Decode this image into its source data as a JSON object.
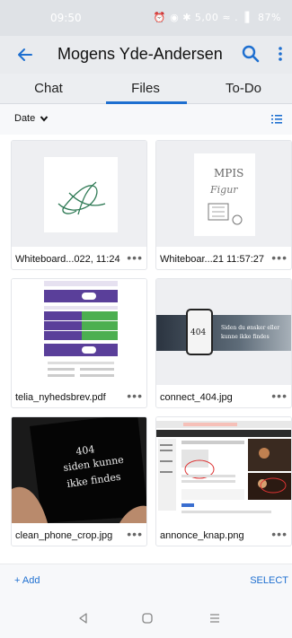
{
  "status_bar": {
    "time": "09:50",
    "right_text": "⏰ ◉ ✱ 5,00 ≈ .▕▍ 87%"
  },
  "header": {
    "title": "Mogens Yde-Andersen"
  },
  "tabs": [
    {
      "label": "Chat",
      "selected": false
    },
    {
      "label": "Files",
      "selected": true
    },
    {
      "label": "To-Do",
      "selected": false
    }
  ],
  "sort": {
    "label": "Date"
  },
  "files": [
    {
      "name": "Whiteboard...022, 11:24",
      "thumb": "whiteboard-signature"
    },
    {
      "name": "Whiteboar...21 11:57:27",
      "thumb": "whiteboard-sketch"
    },
    {
      "name": "telia_nyhedsbrev.pdf",
      "thumb": "newsletter"
    },
    {
      "name": "connect_404.jpg",
      "thumb": "banner-404"
    },
    {
      "name": "clean_phone_crop.jpg",
      "thumb": "phone-404"
    },
    {
      "name": "annonce_knap.png",
      "thumb": "webpage-screenshot"
    }
  ],
  "thumb_texts": {
    "sketch": [
      "MPIS",
      "Figur"
    ],
    "banner_phone": "404",
    "banner_text": [
      "Siden du ønsker eller",
      "kunne ikke findes"
    ],
    "phone": [
      "404",
      "siden kunne",
      "ikke findes"
    ]
  },
  "bottom_bar": {
    "add_label": "+ Add",
    "select_label": "SELECT"
  },
  "colors": {
    "accent": "#1e6fd0",
    "newsletter_purple": "#5a3f9a",
    "newsletter_green": "#4caf50"
  }
}
